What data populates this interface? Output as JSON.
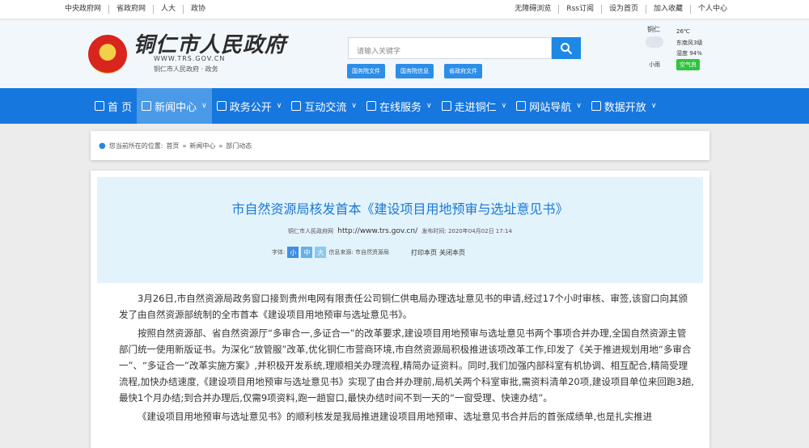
{
  "topbar": {
    "left_links": [
      "中央政府网",
      "省政府网",
      "人大",
      "政协"
    ],
    "right_links": [
      "无障碍浏览",
      "Rss订阅",
      "设为首页",
      "加入收藏",
      "个人中心"
    ]
  },
  "header": {
    "logo_title": "铜仁市人民政府",
    "logo_url": "WWW.TRS.GOV.CN",
    "logo_sub": "铜仁市人民政府 · 政务",
    "search_placeholder": "请输入关键字",
    "quick_links": [
      "国务院文件",
      "国务院信息",
      "省政府文件"
    ],
    "weather": {
      "city": "铜仁",
      "temp": "26℃",
      "wind": "东南风3级",
      "humidity": "湿度 94%",
      "desc": "小雨",
      "air": "空气良"
    }
  },
  "nav": {
    "items": [
      {
        "label": "首 页",
        "chevron": false
      },
      {
        "label": "新闻中心",
        "chevron": true
      },
      {
        "label": "政务公开",
        "chevron": true
      },
      {
        "label": "互动交流",
        "chevron": true
      },
      {
        "label": "在线服务",
        "chevron": true
      },
      {
        "label": "走进铜仁",
        "chevron": true
      },
      {
        "label": "网站导航",
        "chevron": true
      },
      {
        "label": "数据开放",
        "chevron": true
      }
    ],
    "active_index": 1
  },
  "breadcrumb": {
    "prefix": "您当前所在的位置:",
    "path": [
      "首页",
      "新闻中心",
      "部门动态"
    ]
  },
  "article": {
    "title": "市自然资源局核发首本《建设项目用地预审与选址意见书》",
    "source_site": "铜仁市人民政府网",
    "url": "http://www.trs.gov.cn/",
    "published_label": "发布时间:",
    "published_time": "2020年04月02日 17:14",
    "font_label": "字体:",
    "font_sizes": [
      "小",
      "中",
      "大"
    ],
    "info_source": "信息来源: 市自然资源局",
    "print_label": "打印本页",
    "close_label": "关闭本页",
    "paragraphs": [
      "3月26日,市自然资源局政务窗口接到贵州电网有限责任公司铜仁供电局办理选址意见书的申请,经过17个小时审核、审签,该窗口向其颁发了由自然资源部统制的全市首本《建设项目用地预审与选址意见书》。",
      "按照自然资源部、省自然资源厅“多审合一,多证合一”的改革要求,建设项目用地预审与选址意见书两个事项合并办理,全国自然资源主管部门统一使用新版证书。为深化“放管服”改革,优化铜仁市营商环境,市自然资源局积极推进该项改革工作,印发了《关于推进规划用地“多审合一”、“多证合一”改革实施方案》,并积极开发系统,理顺相关办理流程,精简办证资料。同时,我们加强内部科室有机协调、相互配合,精简受理流程,加快办结速度,《建设项目用地预审与选址意见书》实现了由合并办理前,局机关两个科室审批,需资料清单20项,建设项目单位来回跑3趟,最快1个月办结;到合并办理后,仅需9项资料,跑一趟窗口,最快办结时间不到一天的“一窗受理、快速办结”。",
      "《建设项目用地预审与选址意见书》的顺利核发是我局推进建设项目用地预审、选址意见书合并后的首张成绩单,也是扎实推进"
    ]
  },
  "colors": {
    "nav_bg": "#1677df",
    "nav_active": "#4b9ae8",
    "title_blue": "#1a78d6",
    "font_small": "#3f8fe0",
    "font_mid": "#64b1ea",
    "font_large": "#8cc8ef"
  }
}
